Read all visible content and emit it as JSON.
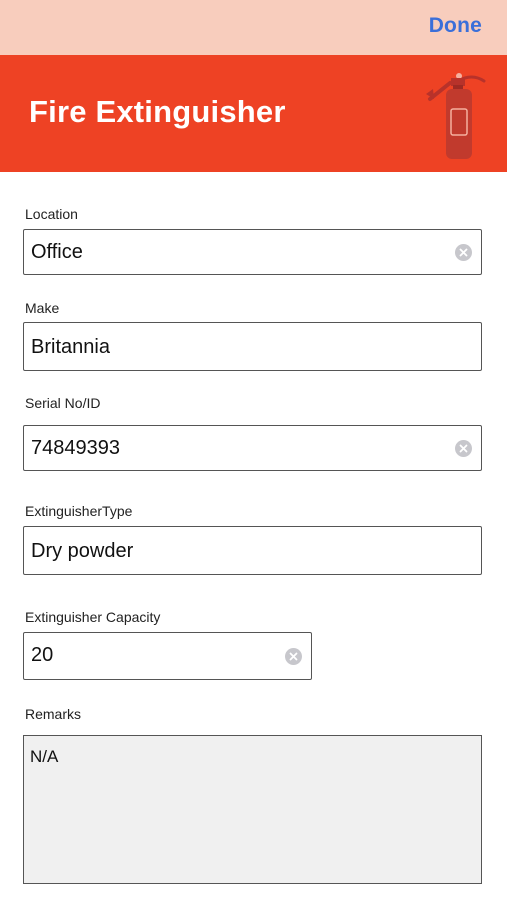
{
  "topbar": {
    "done_label": "Done"
  },
  "header": {
    "title": "Fire Extinguisher",
    "icon": "fire-extinguisher-icon"
  },
  "form": {
    "location": {
      "label": "Location",
      "value": "Office"
    },
    "make": {
      "label": "Make",
      "value": "Britannia"
    },
    "serial": {
      "label": "Serial No/ID",
      "value": "74849393"
    },
    "type": {
      "label": "ExtinguisherType",
      "value": "Dry powder"
    },
    "capacity": {
      "label": "Extinguisher Capacity",
      "value": "20"
    },
    "remarks": {
      "label": "Remarks",
      "value": "N/A"
    }
  },
  "colors": {
    "topbar": "#f8cdbd",
    "header": "#ee4224",
    "accent": "#3b6fd9",
    "remarks_bg": "#f0f0f0"
  }
}
